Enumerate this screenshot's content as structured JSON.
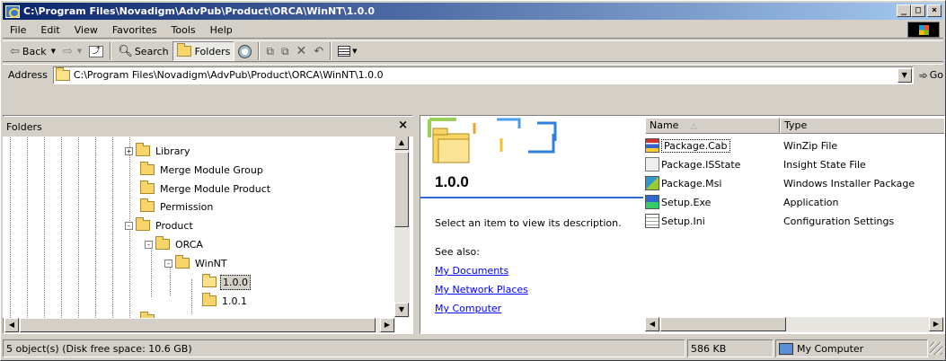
{
  "window": {
    "title": "C:\\Program Files\\Novadigm\\AdvPub\\Product\\ORCA\\WinNT\\1.0.0",
    "minimize": "_",
    "maximize": "□",
    "close": "×"
  },
  "menu": [
    "File",
    "Edit",
    "View",
    "Favorites",
    "Tools",
    "Help"
  ],
  "toolbar": {
    "back": "Back",
    "search": "Search",
    "folders": "Folders"
  },
  "address": {
    "label": "Address",
    "value": "C:\\Program Files\\Novadigm\\AdvPub\\Product\\ORCA\\WinNT\\1.0.0",
    "go": "Go"
  },
  "folders_pane": {
    "title": "Folders",
    "close": "×",
    "items": [
      {
        "label": "Library",
        "expander": "+",
        "level": 0
      },
      {
        "label": "Merge Module Group",
        "expander": "",
        "level": 0
      },
      {
        "label": "Merge Module Product",
        "expander": "",
        "level": 0
      },
      {
        "label": "Permission",
        "expander": "",
        "level": 0
      },
      {
        "label": "Product",
        "expander": "-",
        "level": 0
      },
      {
        "label": "ORCA",
        "expander": "-",
        "level": 1
      },
      {
        "label": "WinNT",
        "expander": "-",
        "level": 2
      },
      {
        "label": "1.0.0",
        "expander": "",
        "level": 3,
        "selected": true
      },
      {
        "label": "1.0.1",
        "expander": "",
        "level": 3
      }
    ]
  },
  "webview": {
    "folder_name": "1.0.0",
    "description": "Select an item to view its description.",
    "see_also": "See also:",
    "links": [
      "My Documents",
      "My Network Places",
      "My Computer"
    ]
  },
  "file_list": {
    "columns": [
      "Name",
      "Type"
    ],
    "rows": [
      {
        "name": "Package.Cab",
        "type": "WinZip File",
        "icon": "winzip-icon"
      },
      {
        "name": "Package.ISState",
        "type": "Insight State File",
        "icon": "isstate-icon"
      },
      {
        "name": "Package.Msi",
        "type": "Windows Installer Package",
        "icon": "msi-icon"
      },
      {
        "name": "Setup.Exe",
        "type": "Application",
        "icon": "exe-icon"
      },
      {
        "name": "Setup.Ini",
        "type": "Configuration Settings",
        "icon": "ini-icon"
      }
    ]
  },
  "status": {
    "objects": "5 object(s) (Disk free space: 10.6 GB)",
    "size": "586 KB",
    "zone": "My Computer"
  },
  "colors": {
    "title_start": "#0a246a",
    "title_end": "#a6caf0",
    "link": "#0000ff",
    "accent_line": "#2f6cd8"
  }
}
